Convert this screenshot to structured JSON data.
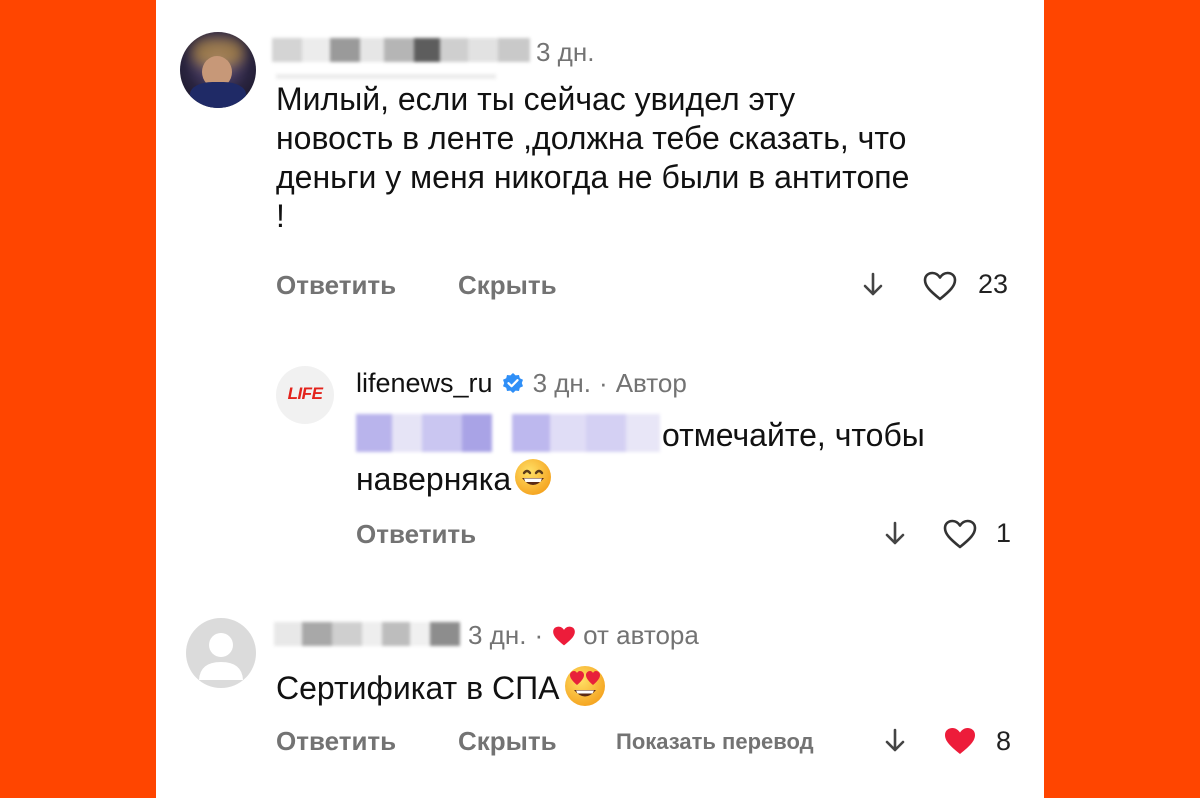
{
  "colors": {
    "frame": "#ff4500",
    "like_red": "#ed1c3a",
    "verified_blue": "#2f8ff7",
    "brand_red": "#e3231c"
  },
  "comments": [
    {
      "time": "3 дн.",
      "text_lines": [
        "Милый, если ты сейчас увидел эту",
        "новость в ленте ,должна тебе сказать, что",
        "деньги у меня никогда не были в антитопе",
        "!"
      ],
      "reply_label": "Ответить",
      "hide_label": "Скрыть",
      "like_count": "23",
      "avatar_icon": "user-photo"
    },
    {
      "username": "lifenews_ru",
      "avatar_logo": "LIFE",
      "time": "3 дн.",
      "separator": "·",
      "author_badge": "Автор",
      "text_line1": "отмечайте, чтобы",
      "text_line2": "наверняка",
      "reply_label": "Ответить",
      "like_count": "1",
      "emoji_icon": "grinning-face-icon"
    },
    {
      "time": "3 дн.",
      "separator": "·",
      "liked_by_author": "от автора",
      "text": "Сертификат в СПА",
      "reply_label": "Ответить",
      "hide_label": "Скрыть",
      "translate_label": "Показать перевод",
      "like_count": "8",
      "emoji_icon": "heart-eyes-icon"
    }
  ]
}
